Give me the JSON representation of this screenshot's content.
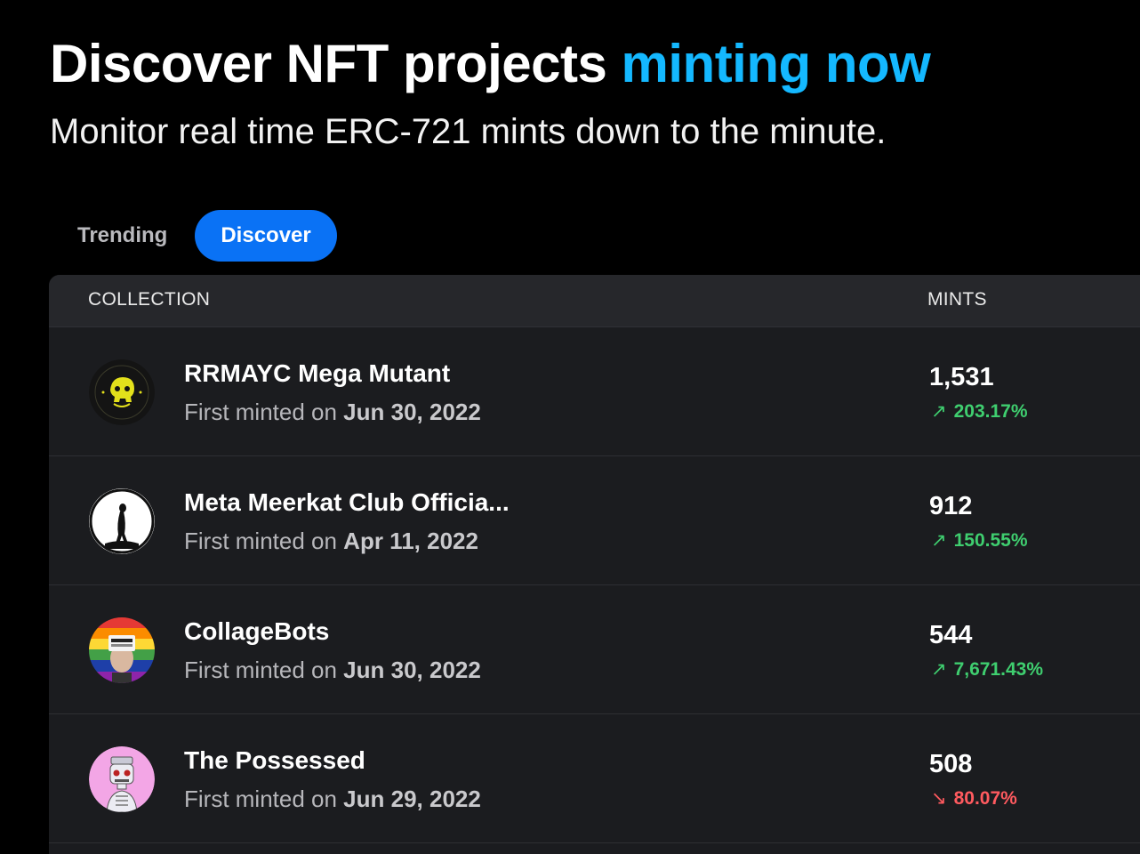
{
  "hero": {
    "title_main": "Discover NFT projects ",
    "title_accent": "minting now",
    "subtitle": "Monitor real time ERC-721 mints down to the minute.",
    "accent_color": "#14b8ff"
  },
  "tabs": [
    {
      "label": "Trending",
      "active": false
    },
    {
      "label": "Discover",
      "active": true
    }
  ],
  "table": {
    "headers": {
      "collection": "COLLECTION",
      "mints": "MINTS"
    },
    "sub_prefix": "First minted on ",
    "rows": [
      {
        "name": "RRMAYC Mega Mutant",
        "date": "Jun 30, 2022",
        "mints": "1,531",
        "change": "203.17%",
        "trend": "up",
        "arrow": "↗",
        "avatar_icon": "ape-skull-badge-icon"
      },
      {
        "name": "Meta Meerkat Club Officia...",
        "date": "Apr 11, 2022",
        "mints": "912",
        "change": "150.55%",
        "trend": "up",
        "arrow": "↗",
        "avatar_icon": "meerkat-silhouette-icon"
      },
      {
        "name": "CollageBots",
        "date": "Jun 30, 2022",
        "mints": "544",
        "change": "7,671.43%",
        "trend": "up",
        "arrow": "↗",
        "avatar_icon": "rainbow-robot-icon"
      },
      {
        "name": "The Possessed",
        "date": "Jun 29, 2022",
        "mints": "508",
        "change": "80.07%",
        "trend": "down",
        "arrow": "↘",
        "avatar_icon": "pink-skeleton-icon"
      }
    ]
  },
  "colors": {
    "up": "#3fce6f",
    "down": "#ff5a5f",
    "tab_active": "#0a72f5"
  }
}
